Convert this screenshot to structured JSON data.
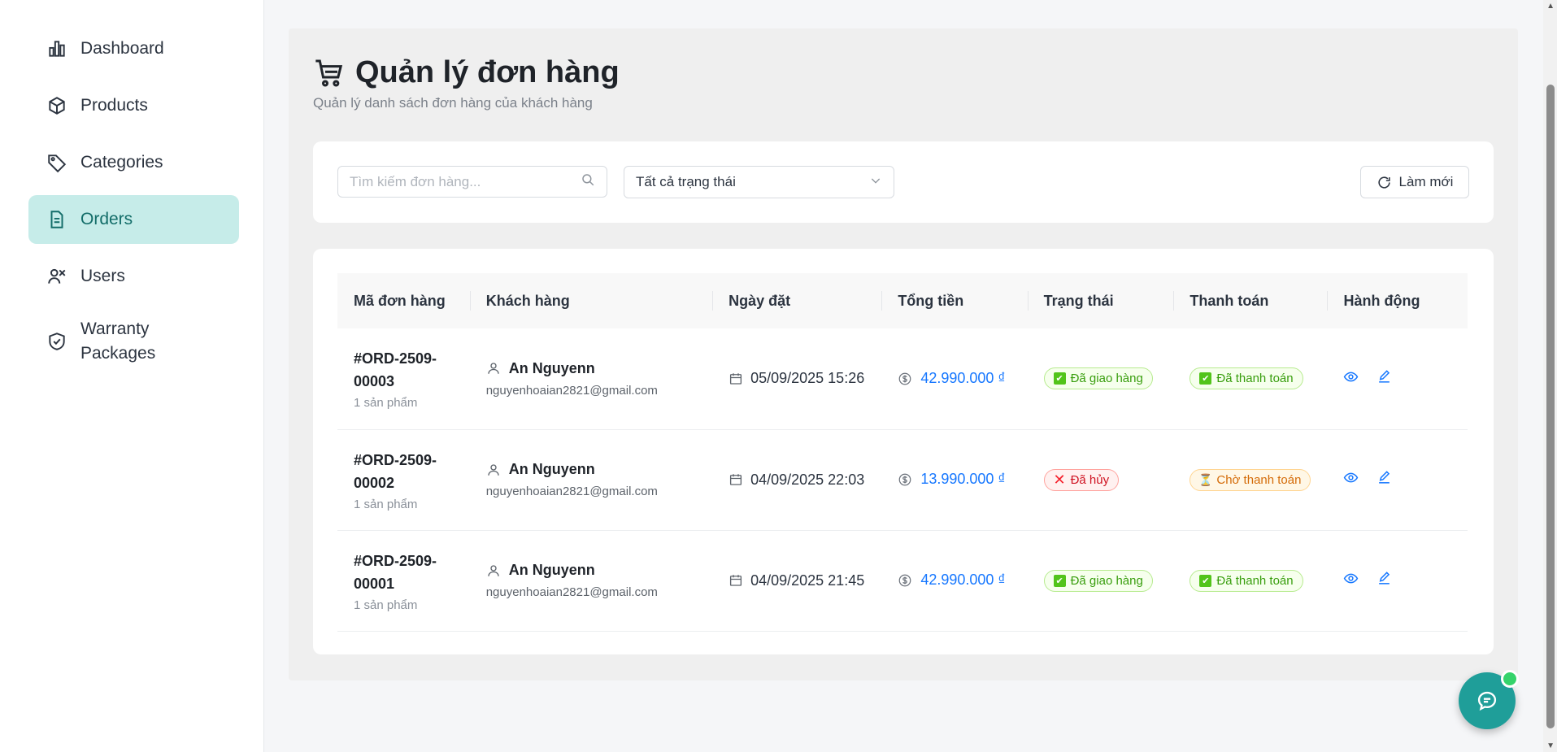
{
  "sidebar": {
    "items": [
      {
        "label": "Dashboard",
        "icon": "bar-chart-icon"
      },
      {
        "label": "Products",
        "icon": "box-icon"
      },
      {
        "label": "Categories",
        "icon": "tag-icon"
      },
      {
        "label": "Orders",
        "icon": "document-icon",
        "active": true
      },
      {
        "label": "Users",
        "icon": "users-icon"
      },
      {
        "label": "Warranty Packages",
        "icon": "shield-check-icon"
      }
    ]
  },
  "header": {
    "title": "Quản lý đơn hàng",
    "subtitle": "Quản lý danh sách đơn hàng của khách hàng"
  },
  "filters": {
    "search_placeholder": "Tìm kiếm đơn hàng...",
    "status_selected": "Tất cả trạng thái",
    "refresh_label": "Làm mới"
  },
  "table": {
    "columns": [
      "Mã đơn hàng",
      "Khách hàng",
      "Ngày đặt",
      "Tổng tiền",
      "Trạng thái",
      "Thanh toán",
      "Hành động"
    ],
    "rows": [
      {
        "id_line1": "#ORD-2509-",
        "id_line2": "00003",
        "items": "1 sản phẩm",
        "customer": "An Nguyenn",
        "email": "nguyenhoaian2821@gmail.com",
        "date": "05/09/2025 15:26",
        "total": "42.990.000 ₫",
        "status": "Đã giao hàng",
        "payment": "Đã thanh toán"
      },
      {
        "id_line1": "#ORD-2509-",
        "id_line2": "00002",
        "items": "1 sản phẩm",
        "customer": "An Nguyenn",
        "email": "nguyenhoaian2821@gmail.com",
        "date": "04/09/2025 22:03",
        "total": "13.990.000 ₫",
        "status": "Đã hủy",
        "payment": "Chờ thanh toán"
      },
      {
        "id_line1": "#ORD-2509-",
        "id_line2": "00001",
        "items": "1 sản phẩm",
        "customer": "An Nguyenn",
        "email": "nguyenhoaian2821@gmail.com",
        "date": "04/09/2025 21:45",
        "total": "42.990.000 ₫",
        "status": "Đã giao hàng",
        "payment": "Đã thanh toán"
      }
    ]
  },
  "colors": {
    "accent": "#1f9e99",
    "active_nav_bg": "#c6ece9",
    "link_blue": "#1677ff",
    "success": "#389e0d",
    "danger": "#cf1322",
    "warning": "#d46b08"
  }
}
